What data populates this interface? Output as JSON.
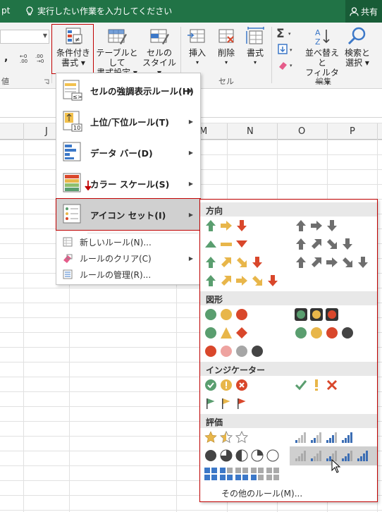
{
  "titlebar": {
    "left_fragment": "pt",
    "tell_me": "実行したい作業を入力してください",
    "share": "共有"
  },
  "ribbon": {
    "buttons": {
      "conditional": "条件付き\n書式",
      "conditional_l1": "条件付き",
      "conditional_l2": "書式 ▾",
      "table_l1": "テーブルとして",
      "table_l2": "書式設定 ▾",
      "style_l1": "セルの",
      "style_l2": "スタイル ▾",
      "insert": "挿入",
      "delete": "削除",
      "format": "書式",
      "sort_l1": "並べ替えと",
      "sort_l2": "フィルター ▾",
      "find_l1": "検索と",
      "find_l2": "選択 ▾"
    },
    "groups": {
      "number_frag": "値",
      "cells": "セル",
      "edit": "編集"
    },
    "number_frag_comma": ","
  },
  "columns": [
    "J",
    "M",
    "N",
    "O",
    "P"
  ],
  "menu1": {
    "items": [
      {
        "label": "セルの強調表示ルール(H)"
      },
      {
        "label": "上位/下位ルール(T)"
      },
      {
        "label": "データ バー(D)"
      },
      {
        "label": "カラー スケール(S)"
      },
      {
        "label": "アイコン セット(I)"
      }
    ],
    "sub": [
      {
        "label": "新しいルール(N)..."
      },
      {
        "label": "ルールのクリア(C)"
      },
      {
        "label": "ルールの管理(R)..."
      }
    ]
  },
  "menu2": {
    "sections": [
      "方向",
      "図形",
      "インジケーター",
      "評価"
    ],
    "more": "その他のルール(M)..."
  },
  "colors": {
    "green": "#217346",
    "red": "#c00000",
    "arrow_green": "#5a9e6f",
    "arrow_yellow": "#e8b64a",
    "arrow_red": "#d9472b",
    "arrow_gray": "#6e6e6e"
  }
}
